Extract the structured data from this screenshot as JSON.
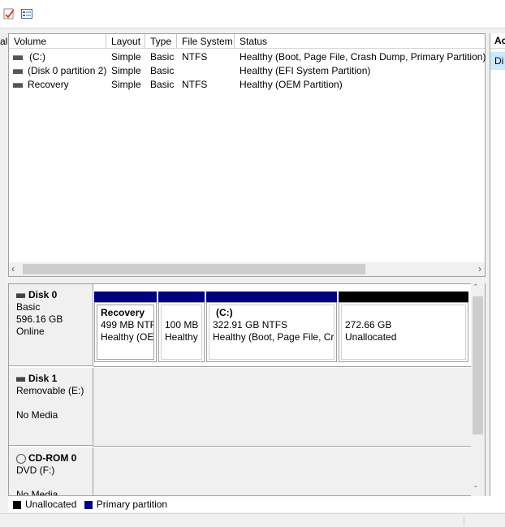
{
  "columns": {
    "cut": "al",
    "volume": "Volume",
    "layout": "Layout",
    "type": "Type",
    "filesystem": "File System",
    "status": "Status"
  },
  "right_header": "Ac",
  "right_item": "Di",
  "volumes": [
    {
      "name": "(C:)",
      "layout": "Simple",
      "type": "Basic",
      "fs": "NTFS",
      "status": "Healthy (Boot, Page File, Crash Dump, Primary Partition)"
    },
    {
      "name": "(Disk 0 partition 2)",
      "layout": "Simple",
      "type": "Basic",
      "fs": "",
      "status": "Healthy (EFI System Partition)"
    },
    {
      "name": "Recovery",
      "layout": "Simple",
      "type": "Basic",
      "fs": "NTFS",
      "status": "Healthy (OEM Partition)"
    }
  ],
  "disk0": {
    "name": "Disk 0",
    "type": "Basic",
    "size": "596.16 GB",
    "state": "Online",
    "partitions": [
      {
        "title": "Recovery",
        "line1": "499 MB NTF",
        "line2": "Healthy (OE"
      },
      {
        "title": "",
        "line1": "100 MB",
        "line2": "Healthy"
      },
      {
        "title": "(C:)",
        "line1": "322.91 GB NTFS",
        "line2": "Healthy (Boot, Page File, Cra"
      },
      {
        "title": "",
        "line1": "272.66 GB",
        "line2": "Unallocated"
      }
    ]
  },
  "disk1": {
    "name": "Disk 1",
    "type": "Removable (E:)",
    "state": "No Media"
  },
  "cdrom0": {
    "name": "CD-ROM 0",
    "type": "DVD (F:)",
    "state": "No Media"
  },
  "legend": {
    "unallocated": "Unallocated",
    "primary": "Primary partition"
  },
  "colors": {
    "primary": "#00007f",
    "unallocated": "#000000",
    "selected_bg": "#cce8ff"
  },
  "icons": {
    "properties": "checklist-icon",
    "help": "window-icon"
  }
}
